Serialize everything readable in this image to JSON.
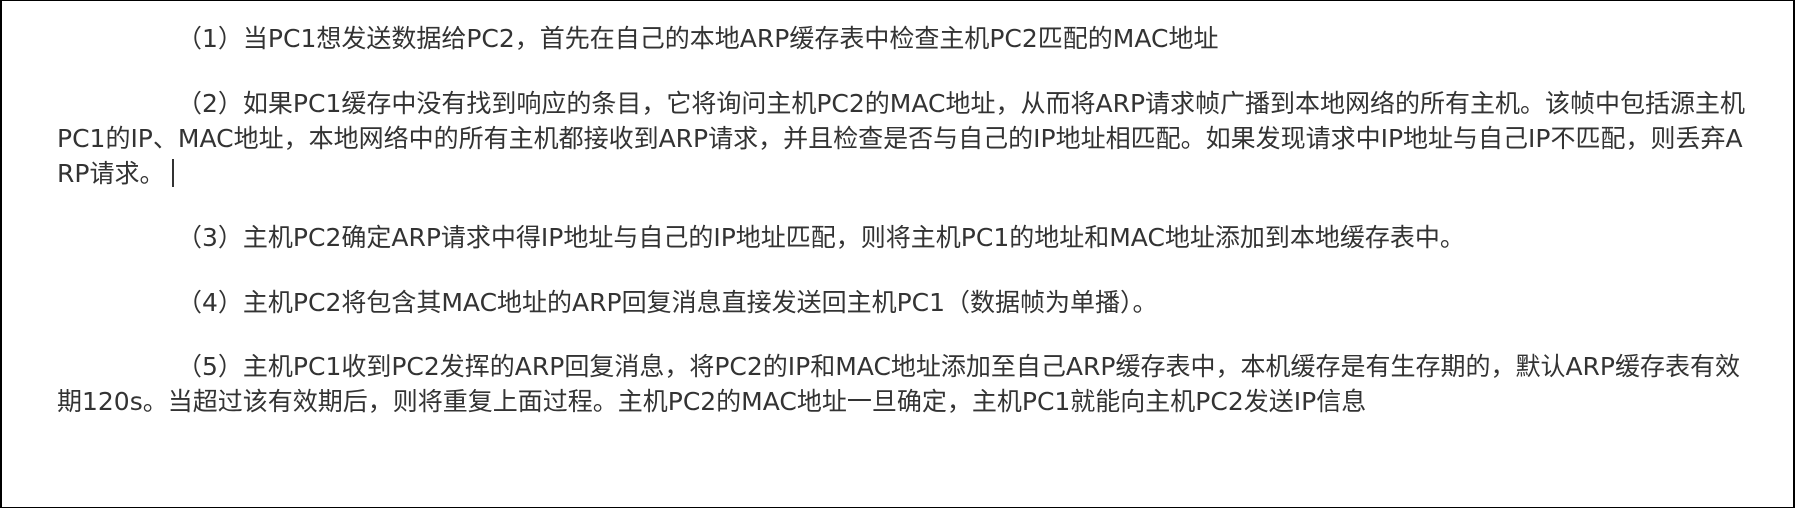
{
  "document": {
    "paragraphs": [
      "（1）当PC1想发送数据给PC2，首先在自己的本地ARP缓存表中检查主机PC2匹配的MAC地址",
      "（2）如果PC1缓存中没有找到响应的条目，它将询问主机PC2的MAC地址，从而将ARP请求帧广播到本地网络的所有主机。该帧中包括源主机PC1的IP、MAC地址，本地网络中的所有主机都接收到ARP请求，并且检查是否与自己的IP地址相匹配。如果发现请求中IP地址与自己IP不匹配，则丢弃ARP请求。",
      "（3）主机PC2确定ARP请求中得IP地址与自己的IP地址匹配，则将主机PC1的地址和MAC地址添加到本地缓存表中。",
      "（4）主机PC2将包含其MAC地址的ARP回复消息直接发送回主机PC1（数据帧为单播）。",
      "（5）主机PC1收到PC2发挥的ARP回复消息，将PC2的IP和MAC地址添加至自己ARP缓存表中，本机缓存是有生存期的，默认ARP缓存表有效期120s。当超过该有效期后，则将重复上面过程。主机PC2的MAC地址一旦确定，主机PC1就能向主机PC2发送IP信息"
    ]
  }
}
